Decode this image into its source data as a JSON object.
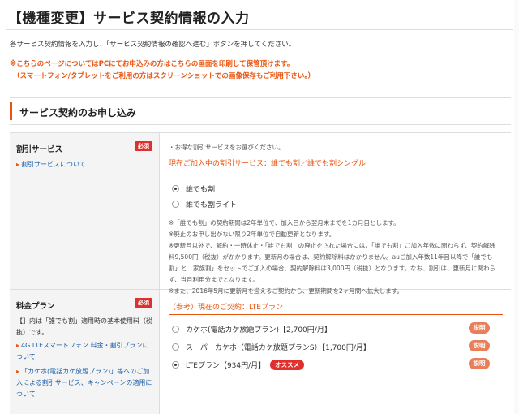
{
  "page": {
    "title": "【機種変更】サービス契約情報の入力",
    "instruction": "各サービス契約情報を入力し、「サービス契約情報の確認へ進む」ボタンを押してください。",
    "notice_line1": "※こちらのページについてはPCにてお申込みの方はこちらの画面を印刷して保管頂けます。",
    "notice_line2": "（スマートフォン/タブレットをご利用の方はスクリーンショットでの画像保存もご利用下さい。）"
  },
  "section": {
    "title": "サービス契約のお申し込み"
  },
  "discount": {
    "field_title": "割引サービス",
    "required_badge": "必須",
    "side_link": "割引サービスについて",
    "prompt": "・お得な割引サービスをお選びください。",
    "current": "現在ご加入中の割引サービス：誰でも割／誰でも割シングル",
    "options": [
      {
        "label": "誰でも割",
        "checked": true
      },
      {
        "label": "誰でも割ライト",
        "checked": false
      }
    ],
    "notes": [
      "※「誰でも割」の契約期間は2年単位で、加入日から翌月末までを1カ月目とします。",
      "※廃止のお申し出がない限り2年単位で自動更新となります。",
      "※更新月以外で、解約・一時休止・「誰でも割」の廃止をされた場合には、「誰でも割」ご加入年数に関わらず、契約解除料9,500円（税抜）がかかります。更新月の場合は、契約解除料はかかりません。auご加入年数11年目以降で「誰でも割」と「家族割」をセットでご加入の場合、契約解除料は3,000円（税抜）となります。なお、割引は、更新月に関わらず、当月利用分までとなります。",
      "※また、2016年5月に更新月を迎えるご契約から、更新期間を2ヶ月間へ拡大します。"
    ]
  },
  "plan": {
    "field_title": "料金プラン",
    "required_badge": "必須",
    "side_text": "【】内は「誰でも割」適用時の基本使用料（税抜）です。",
    "side_link1": "4G LTEスマートフォン 料金・割引プランについて",
    "side_link2": "「カケホ(電話カケ放題プラン)」等へのご加入による割引サービス、キャンペーンの適用について",
    "reference": "（参考）現在のご契約：LTEプラン",
    "options": [
      {
        "label": "カケホ(電話カケ放題プラン)【2,700円/月】",
        "checked": false,
        "badge": ""
      },
      {
        "label": "スーパーカケホ（電話カケ放題プランS）【1,700円/月】",
        "checked": false,
        "badge": ""
      },
      {
        "label": "LTEプラン【934円/月】",
        "checked": true,
        "badge": "オススメ"
      }
    ],
    "explain_label": "説明"
  }
}
